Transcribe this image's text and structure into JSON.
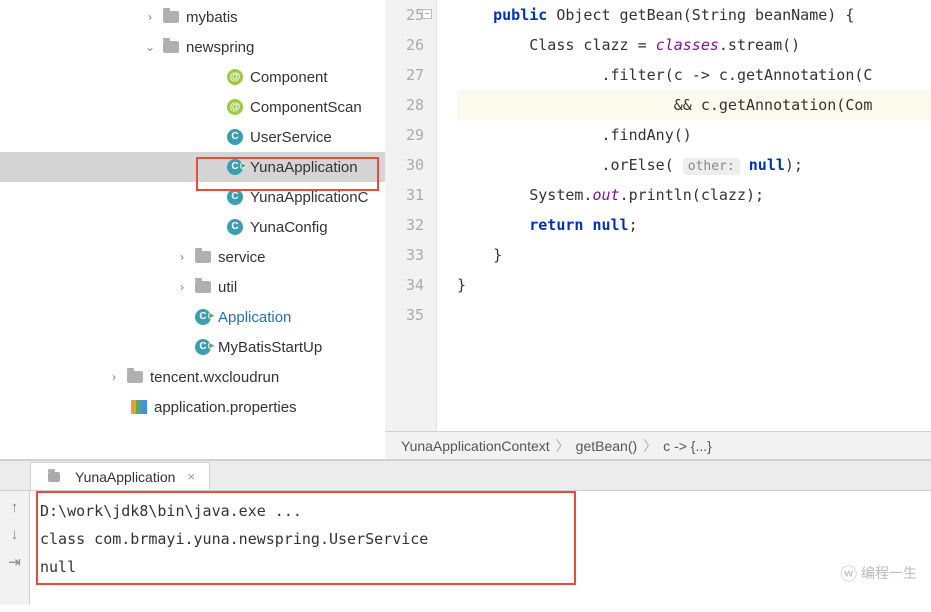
{
  "tree": {
    "items": [
      {
        "label": "mybatis",
        "icon": "folder",
        "chevron": "right",
        "indent": 0
      },
      {
        "label": "newspring",
        "icon": "folder",
        "chevron": "down",
        "indent": 0
      },
      {
        "label": "Component",
        "icon": "at",
        "indent": 2
      },
      {
        "label": "ComponentScan",
        "icon": "at",
        "indent": 2
      },
      {
        "label": "UserService",
        "icon": "class",
        "indent": 2
      },
      {
        "label": "YunaApplication",
        "icon": "class-run",
        "indent": 2,
        "selected": true
      },
      {
        "label": "YunaApplicationC",
        "icon": "class",
        "indent": 2
      },
      {
        "label": "YunaConfig",
        "icon": "class",
        "indent": 2
      },
      {
        "label": "service",
        "icon": "folder",
        "chevron": "right",
        "indent": 1
      },
      {
        "label": "util",
        "icon": "folder",
        "chevron": "right",
        "indent": 1
      },
      {
        "label": "Application",
        "icon": "class-run",
        "indent": 1,
        "link": true
      },
      {
        "label": "MyBatisStartUp",
        "icon": "class-run",
        "indent": 1
      },
      {
        "label": "tencent.wxcloudrun",
        "icon": "folder",
        "chevron": "right",
        "indent": 3
      },
      {
        "label": "application.properties",
        "icon": "props",
        "indent": 4
      }
    ]
  },
  "gutter": {
    "start": 25,
    "end": 35
  },
  "code": {
    "lines": [
      {
        "n": 25,
        "html": "    <span class='kw'>public</span> Object getBean(String beanName) {"
      },
      {
        "n": 26,
        "html": "        Class clazz = <span class='field'>classes</span>.stream()"
      },
      {
        "n": 27,
        "html": "                .filter(c -> c.getAnnotation(C"
      },
      {
        "n": 28,
        "html": "                        && c.getAnnotation(Com",
        "hl": true
      },
      {
        "n": 29,
        "html": "                .findAny()"
      },
      {
        "n": 30,
        "html": "                .orElse( <span class='hint'>other:</span> <span class='kw'>null</span>);"
      },
      {
        "n": 31,
        "html": "        System.<span class='field'>out</span>.println(clazz);"
      },
      {
        "n": 32,
        "html": "        <span class='kw'>return null</span>;"
      },
      {
        "n": 33,
        "html": "    }"
      },
      {
        "n": 34,
        "html": "}"
      },
      {
        "n": 35,
        "html": ""
      }
    ]
  },
  "breadcrumb": {
    "0": "YunaApplicationContext",
    "1": "getBean()",
    "2": "c -> {...}"
  },
  "run": {
    "tab": "YunaApplication",
    "out0": "D:\\work\\jdk8\\bin\\java.exe ...",
    "out1": "class com.brmayi.yuna.newspring.UserService",
    "out2": "null"
  },
  "watermark": "编程一生"
}
